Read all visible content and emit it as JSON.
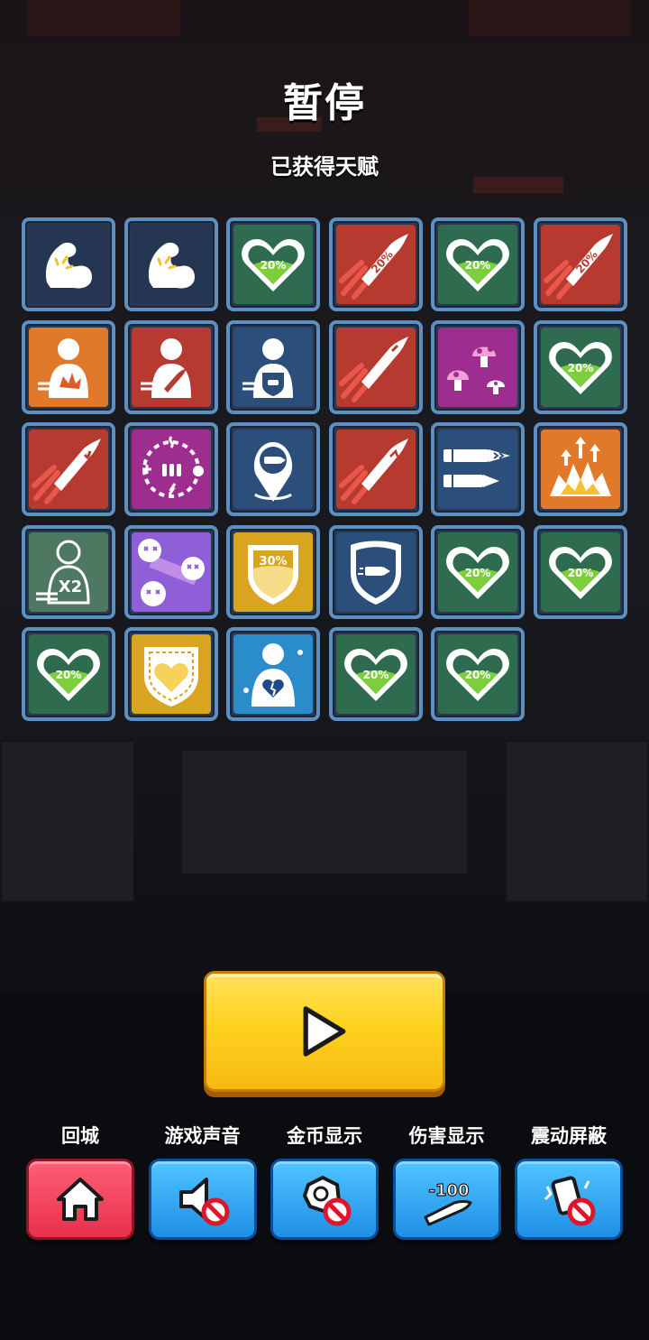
{
  "title": "暂停",
  "subtitle": "已获得天赋",
  "talents": [
    {
      "icon": "muscle-arm-icon",
      "color": "#243652"
    },
    {
      "icon": "muscle-arm-icon",
      "color": "#243652"
    },
    {
      "icon": "heart-20-icon",
      "color": "#2f6b4e",
      "label": "20%"
    },
    {
      "icon": "bullet-20-icon",
      "color": "#b73a30",
      "label": "20%"
    },
    {
      "icon": "heart-20-icon",
      "color": "#2f6b4e",
      "label": "20%"
    },
    {
      "icon": "bullet-20-icon",
      "color": "#b73a30",
      "label": "20%"
    },
    {
      "icon": "target-explosion-icon",
      "color": "#e07a2a"
    },
    {
      "icon": "target-bullet-icon",
      "color": "#b73a30"
    },
    {
      "icon": "target-shield-icon",
      "color": "#2c4e7a"
    },
    {
      "icon": "bullet-spark-icon",
      "color": "#b73a30"
    },
    {
      "icon": "mushrooms-icon",
      "color": "#9d2d8f"
    },
    {
      "icon": "heart-20-icon",
      "color": "#2f6b4e",
      "label": "20%"
    },
    {
      "icon": "bullet-angry-icon",
      "color": "#b73a30"
    },
    {
      "icon": "elemental-ammo-icon",
      "color": "#9d2d8f"
    },
    {
      "icon": "bullet-location-icon",
      "color": "#2c4e7a"
    },
    {
      "icon": "bullet-arrows-icon",
      "color": "#b73a30"
    },
    {
      "icon": "double-bullet-icon",
      "color": "#2c4e7a"
    },
    {
      "icon": "explosion-up-icon",
      "color": "#e07a2a"
    },
    {
      "icon": "target-x2-icon",
      "color": "#4f7863",
      "label": "X2"
    },
    {
      "icon": "dead-pigs-icon",
      "color": "#8e5fd6"
    },
    {
      "icon": "shield-30-icon",
      "color": "#d9a420",
      "label": "30%"
    },
    {
      "icon": "bullet-shield-icon",
      "color": "#2c4e7a"
    },
    {
      "icon": "heart-20-icon",
      "color": "#2f6b4e",
      "label": "20%"
    },
    {
      "icon": "heart-20-icon",
      "color": "#2f6b4e",
      "label": "20%"
    },
    {
      "icon": "heart-20-icon",
      "color": "#2f6b4e",
      "label": "20%"
    },
    {
      "icon": "golden-heart-shield-icon",
      "color": "#d9a420"
    },
    {
      "icon": "broken-heart-target-icon",
      "color": "#2b8ccc"
    },
    {
      "icon": "heart-20-icon",
      "color": "#2f6b4e",
      "label": "20%"
    },
    {
      "icon": "heart-20-icon",
      "color": "#2f6b4e",
      "label": "20%"
    }
  ],
  "play_icon": "play-icon",
  "settings": [
    {
      "label": "回城",
      "icon": "home-icon"
    },
    {
      "label": "游戏声音",
      "icon": "sound-off-icon"
    },
    {
      "label": "金币显示",
      "icon": "coin-display-off-icon"
    },
    {
      "label": "伤害显示",
      "icon": "damage-display-icon",
      "value": "-100"
    },
    {
      "label": "震动屏蔽",
      "icon": "vibration-off-icon"
    }
  ]
}
